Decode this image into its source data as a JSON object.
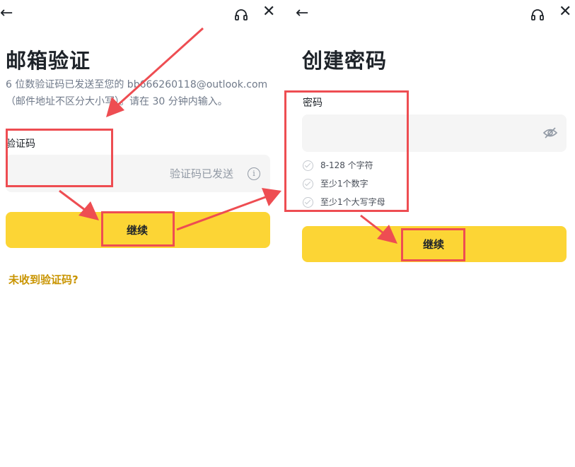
{
  "left": {
    "back_icon": "arrow-left-icon",
    "headset_icon": "headset-icon",
    "close_icon": "close-icon",
    "title": "邮箱验证",
    "description_line1": "6 位数验证码已发送至您的 bb666260118@outlook.com",
    "description_line2": "（邮件地址不区分大小写）。请在 30 分钟内输入。",
    "code_label": "验证码",
    "code_value": "",
    "code_status": "验证码已发送",
    "info_icon": "info-icon",
    "continue_label": "继续",
    "resend_link": "未收到验证码?"
  },
  "right": {
    "back_icon": "arrow-left-icon",
    "headset_icon": "headset-icon",
    "close_icon": "close-icon",
    "title": "创建密码",
    "password_label": "密码",
    "password_value": "",
    "eye_icon": "eye-off-icon",
    "requirements": [
      "8-128 个字符",
      "至少1个数字",
      "至少1个大写字母"
    ],
    "continue_label": "继续"
  },
  "colors": {
    "accent_yellow": "#fcd535",
    "link_gold": "#c99400",
    "annotation_red": "#ee4d52",
    "input_bg": "#f5f5f5"
  }
}
